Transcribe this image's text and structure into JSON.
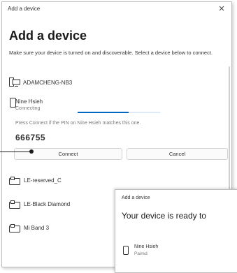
{
  "dialog": {
    "window_title": "Add a device",
    "heading": "Add a device",
    "description": "Make sure your device is turned on and discoverable. Select a device below to connect."
  },
  "devices": [
    {
      "name": "ADAMCHENG-NB3",
      "icon": "desktop-computer-icon"
    },
    {
      "name": "Nine Hsieh",
      "status": "Connecting",
      "icon": "phone-icon"
    },
    {
      "name": "LE-reserved_C",
      "icon": "input-device-icon"
    },
    {
      "name": "LE-Black Diamond",
      "icon": "input-device-icon"
    },
    {
      "name": "Mi Band 3",
      "icon": "input-device-icon"
    }
  ],
  "pairing": {
    "note": "Press Connect if the PIN on Nine Hsieh matches this one.",
    "pin": "666755",
    "connect_label": "Connect",
    "cancel_label": "Cancel",
    "progress": 0.62
  },
  "ready_dialog": {
    "window_title": "Add a device",
    "heading": "Your device is ready to",
    "device_name": "Nine Hsieh",
    "device_status": "Paired",
    "device_icon": "phone-icon"
  },
  "colors": {
    "accent": "#0067c0",
    "text": "#1b1b1b",
    "secondary_text": "#7a7a7a"
  }
}
